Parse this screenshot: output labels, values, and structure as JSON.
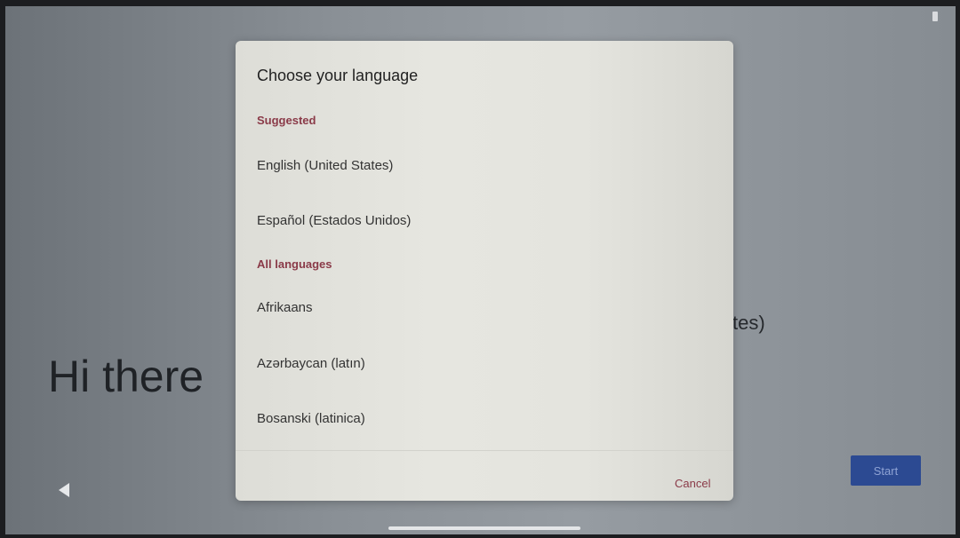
{
  "background": {
    "greeting": "Hi there",
    "language_fragment": "tes)",
    "start_label": "Start"
  },
  "dialog": {
    "title": "Choose your language",
    "suggested_header": "Suggested",
    "suggested": [
      "English (United States)",
      "Español (Estados Unidos)"
    ],
    "all_header": "All languages",
    "all": [
      "Afrikaans",
      "Azərbaycan (latın)",
      "Bosanski (latinica)"
    ],
    "cancel_label": "Cancel"
  },
  "colors": {
    "accent": "#8a3a48",
    "start_button": "#2c4a92"
  },
  "icons": [
    "battery-icon",
    "back-icon",
    "home-bar"
  ]
}
